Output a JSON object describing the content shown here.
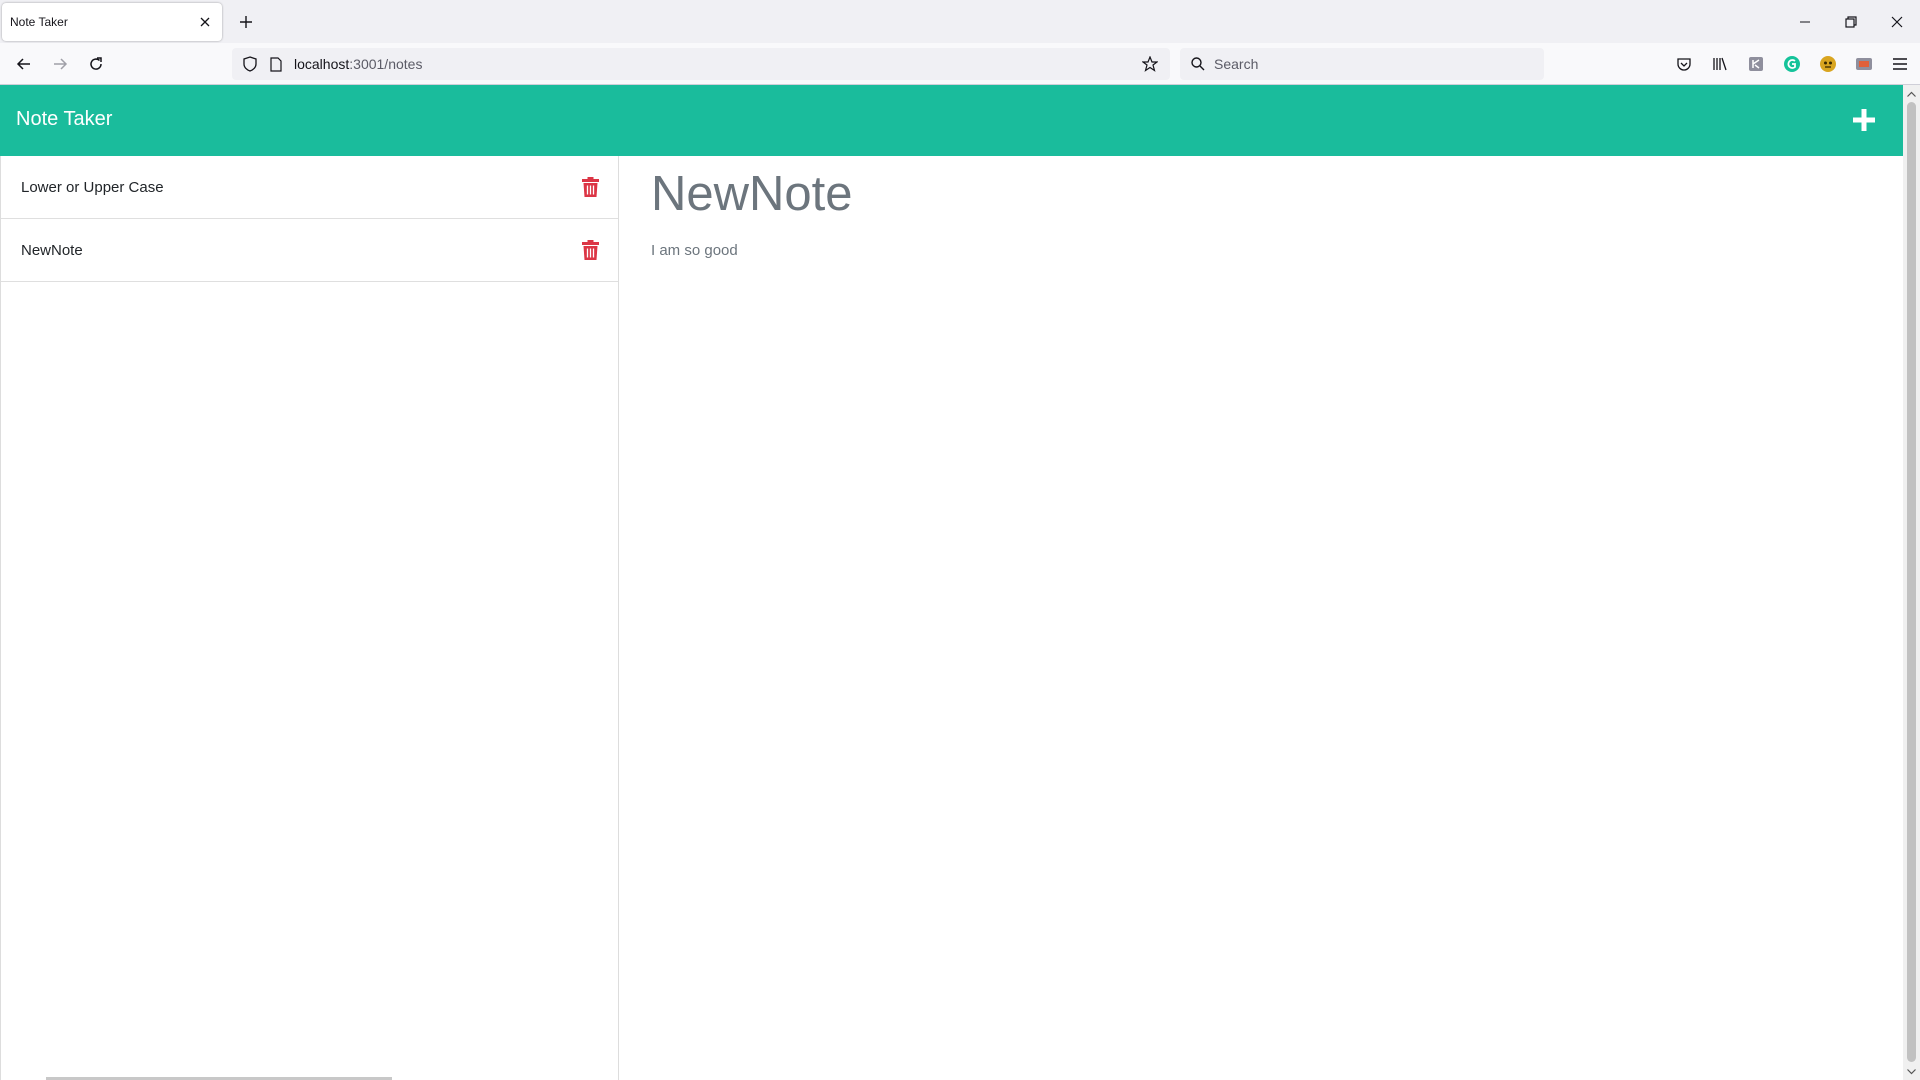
{
  "browser": {
    "tab_title": "Note Taker",
    "url_host": "localhost",
    "url_path": ":3001/notes",
    "search_placeholder": "Search"
  },
  "app": {
    "title": "Note Taker",
    "accent_color": "#1abc9c",
    "delete_color": "#dc3545"
  },
  "notes": [
    {
      "title": "Lower or Upper Case"
    },
    {
      "title": "NewNote"
    }
  ],
  "active_note": {
    "title": "NewNote",
    "text": "I am so good"
  }
}
